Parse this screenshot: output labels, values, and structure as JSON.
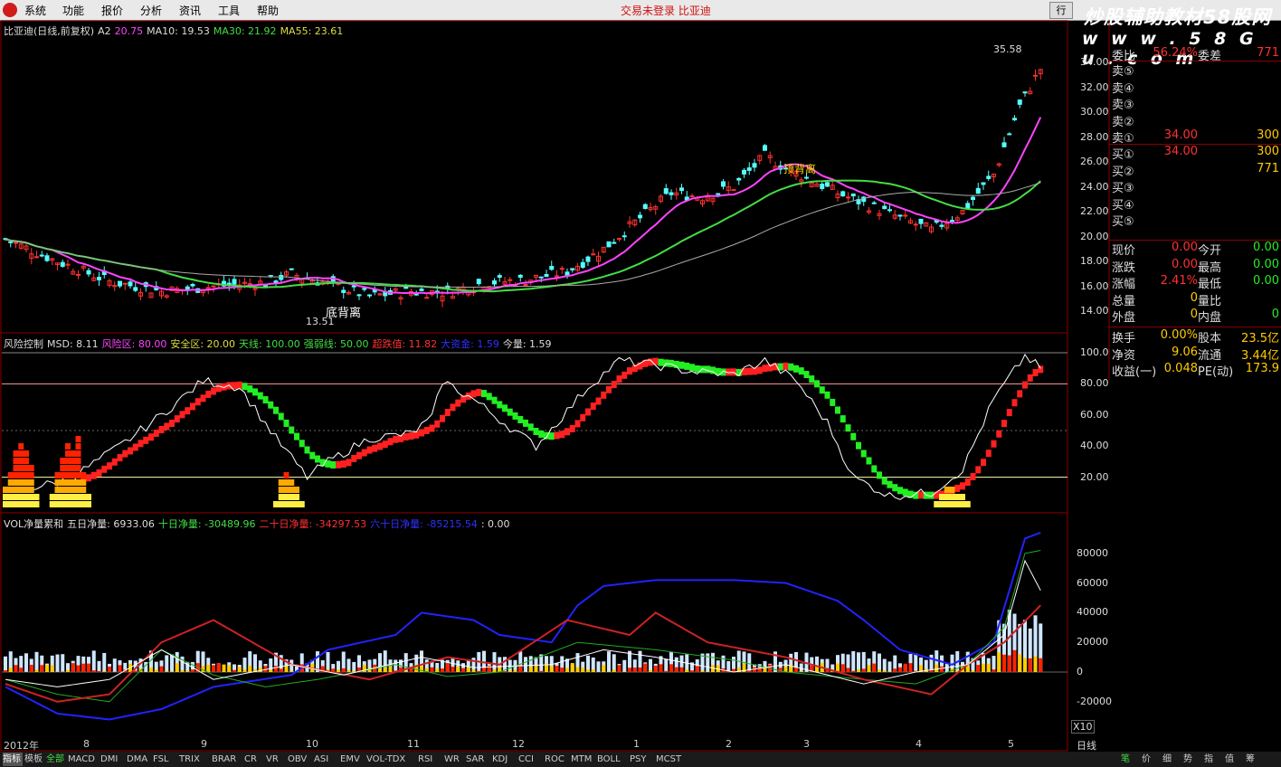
{
  "menu": {
    "items": [
      "系统",
      "功能",
      "报价",
      "分析",
      "资讯",
      "工具",
      "帮助"
    ],
    "center": "交易未登录  比亚迪",
    "btn_trade": "行"
  },
  "watermark": {
    "line1": "炒股辅助教材58股网",
    "line2": "w w w . 5 8 G u . c o m"
  },
  "main_legend": {
    "name": "比亚迪(日线,前复权)",
    "a2": "A2",
    "a2v": "20.75",
    "ma10": "MA10: 19.53",
    "ma30": "MA30: 21.92",
    "ma55": "MA55: 23.61"
  },
  "main_annotations": {
    "high": "35.58",
    "low": "13.51",
    "low_text": "底背离",
    "top_text": "顶背离"
  },
  "price_axis": [
    "34.00",
    "32.00",
    "30.00",
    "28.00",
    "26.00",
    "24.00",
    "22.00",
    "20.00",
    "18.00",
    "16.00",
    "14.00"
  ],
  "risk_legend": {
    "name": "风险控制",
    "msd": "MSD: 8.11",
    "fxq": "风险区: 80.00",
    "aqq": "安全区: 20.00",
    "tx": "天线: 100.00",
    "qrx": "强弱线: 50.00",
    "cdz": "超跌值: 11.82",
    "dxl": "大资金: 1.59",
    "ll": "今量: 1.59"
  },
  "risk_axis": [
    "100.0",
    "80.00",
    "60.00",
    "40.00",
    "20.00"
  ],
  "vol_legend": {
    "name": "VOL净量累和",
    "w5": "五日净量: 6933.06",
    "w10": "十日净量: -30489.96",
    "w20": "二十日净量: -34297.53",
    "w60": "六十日净量: -85215.54",
    "zero": ": 0.00"
  },
  "vol_axis": [
    "80000",
    "60000",
    "40000",
    "20000",
    "0",
    "-20000"
  ],
  "vol_unit": "X10",
  "months": [
    "2012年",
    "8",
    "9",
    "10",
    "11",
    "12",
    "1",
    "2",
    "3",
    "4",
    "5"
  ],
  "period": "日线",
  "right_panel": {
    "top_row": {
      "a": "委比",
      "b": "56.24%",
      "c": "委差",
      "d": "771"
    },
    "sell": [
      {
        "a": "卖⑤",
        "b": "",
        "d": ""
      },
      {
        "a": "卖④",
        "b": "",
        "d": ""
      },
      {
        "a": "卖③",
        "b": "",
        "d": ""
      },
      {
        "a": "卖②",
        "b": "",
        "d": ""
      },
      {
        "a": "卖①",
        "b": "34.00",
        "d": "300"
      }
    ],
    "buy": [
      {
        "a": "买①",
        "b": "34.00",
        "d": "300"
      },
      {
        "a": "买②",
        "b": "",
        "d": "771"
      },
      {
        "a": "买③",
        "b": "",
        "d": ""
      },
      {
        "a": "买④",
        "b": "",
        "d": ""
      },
      {
        "a": "买⑤",
        "b": "",
        "d": ""
      }
    ],
    "quote": [
      {
        "a": "现价",
        "b": "0.00",
        "c": "今开",
        "d": "0.00"
      },
      {
        "a": "涨跌",
        "b": "0.00",
        "c": "最高",
        "d": "0.00"
      },
      {
        "a": "涨幅",
        "b": "2.41%",
        "c": "最低",
        "d": "0.00"
      },
      {
        "a": "总量",
        "b": "0",
        "c": "量比",
        "d": ""
      },
      {
        "a": "外盘",
        "b": "0",
        "c": "内盘",
        "d": "0"
      }
    ],
    "fund": [
      {
        "a": "换手",
        "b": "0.00%",
        "c": "股本",
        "d": "23.5亿"
      },
      {
        "a": "净资",
        "b": "9.06",
        "c": "流通",
        "d": "3.44亿"
      },
      {
        "a": "收益(一)",
        "b": "0.048",
        "c": "PE(动)",
        "d": "173.9"
      }
    ]
  },
  "tabs": [
    "指标",
    "模板",
    "全部",
    "MACD",
    "DMI",
    "DMA",
    "FSL",
    "TRIX",
    "BRAR",
    "CR",
    "VR",
    "OBV",
    "ASI",
    "EMV",
    "VOL-TDX",
    "RSI",
    "WR",
    "SAR",
    "KDJ",
    "CCI",
    "ROC",
    "MTM",
    "BOLL",
    "PSY",
    "MCST"
  ],
  "right_tabs": [
    "笔",
    "价",
    "细",
    "势",
    "指",
    "值",
    "筹"
  ],
  "colors": {
    "up": "#ff3030",
    "down": "#54ffff",
    "ma10": "#ff44ff",
    "ma30": "#44dd44",
    "ma55": "#cccccc",
    "accent_red": "#ff2020",
    "accent_green": "#22ee22"
  }
}
